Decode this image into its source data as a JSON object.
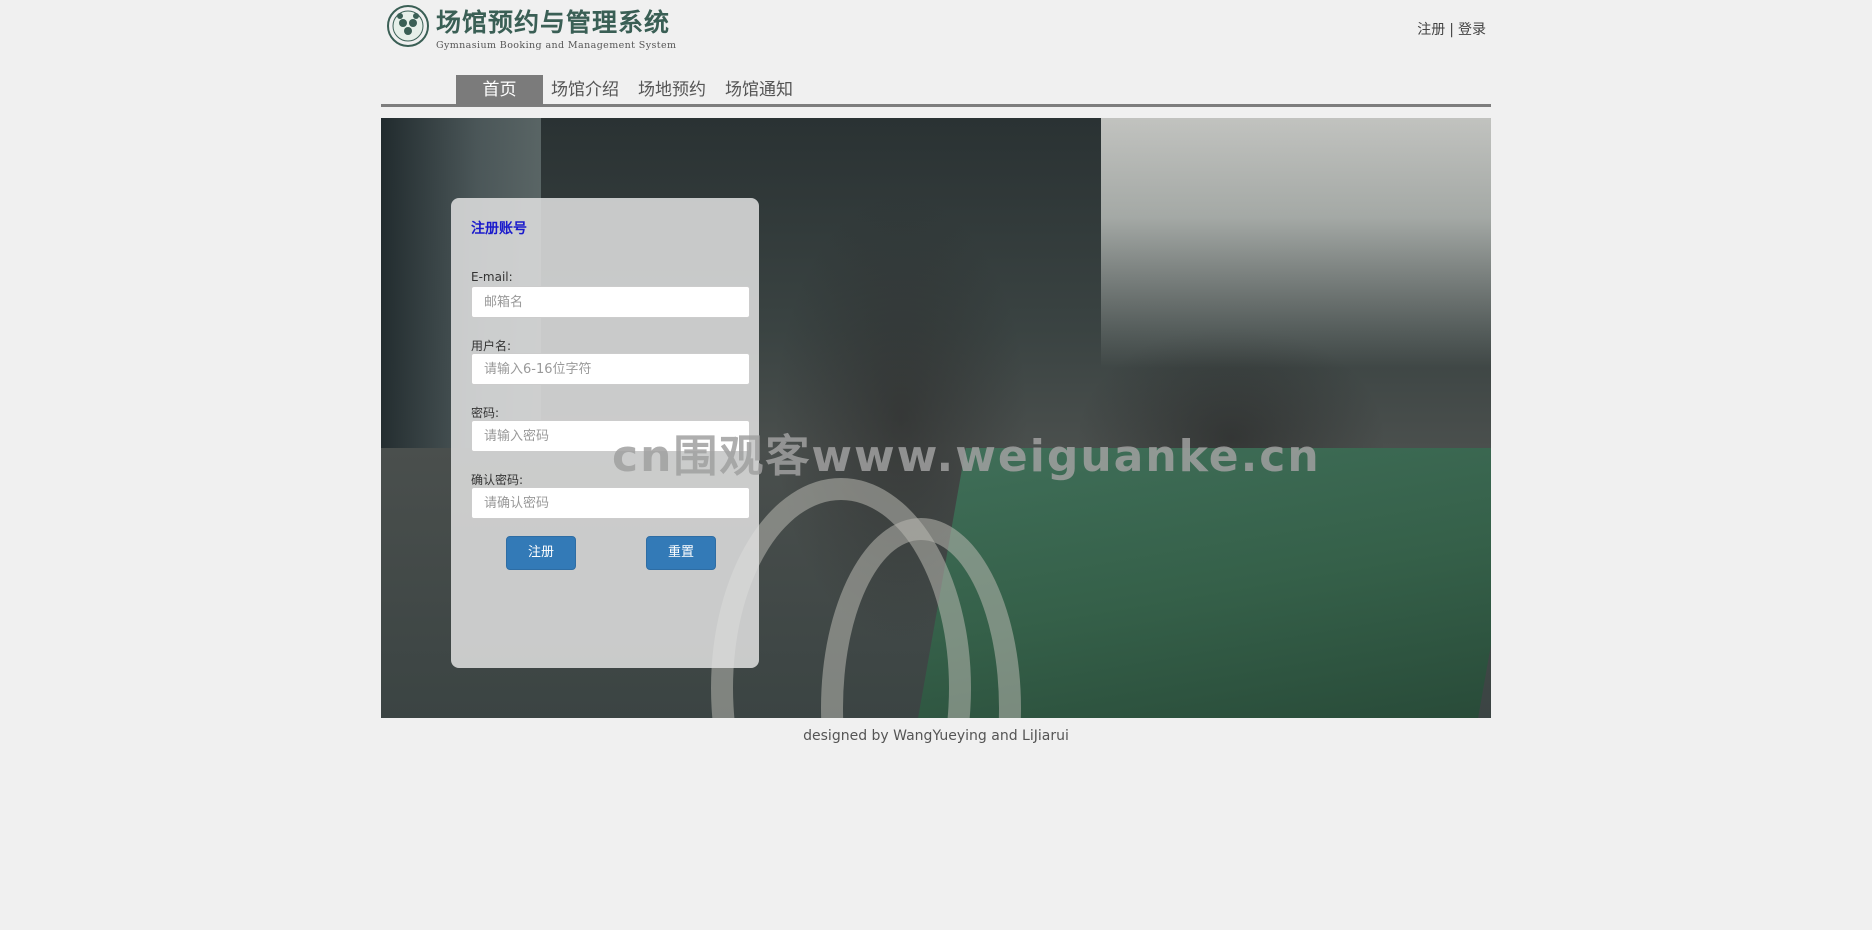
{
  "header": {
    "logo_title": "场馆预约与管理系统",
    "logo_subtitle": "Gymnasium Booking and Management System",
    "auth_register": "注册",
    "auth_separator": "|",
    "auth_login": "登录"
  },
  "nav": {
    "items": [
      {
        "label": "首页",
        "active": true
      },
      {
        "label": "场馆介绍",
        "active": false
      },
      {
        "label": "场地预约",
        "active": false
      },
      {
        "label": "场馆通知",
        "active": false
      }
    ]
  },
  "form": {
    "title": "注册账号",
    "email_label": "E-mail:",
    "email_placeholder": "邮箱名",
    "username_label": "用户名:",
    "username_placeholder": "请输入6-16位字符",
    "password_label": "密码:",
    "password_placeholder": "请输入密码",
    "confirm_label": "确认密码:",
    "confirm_placeholder": "请确认密码",
    "submit_label": "注册",
    "reset_label": "重置"
  },
  "watermark": "cn围观客www.weiguanke.cn",
  "footer": {
    "text": "designed by WangYueying and LiJiarui"
  },
  "colors": {
    "nav_active_bg": "#7b7b7b",
    "button_bg": "#337ab7",
    "form_title": "#1a1acc",
    "logo_text": "#3a5f55"
  }
}
